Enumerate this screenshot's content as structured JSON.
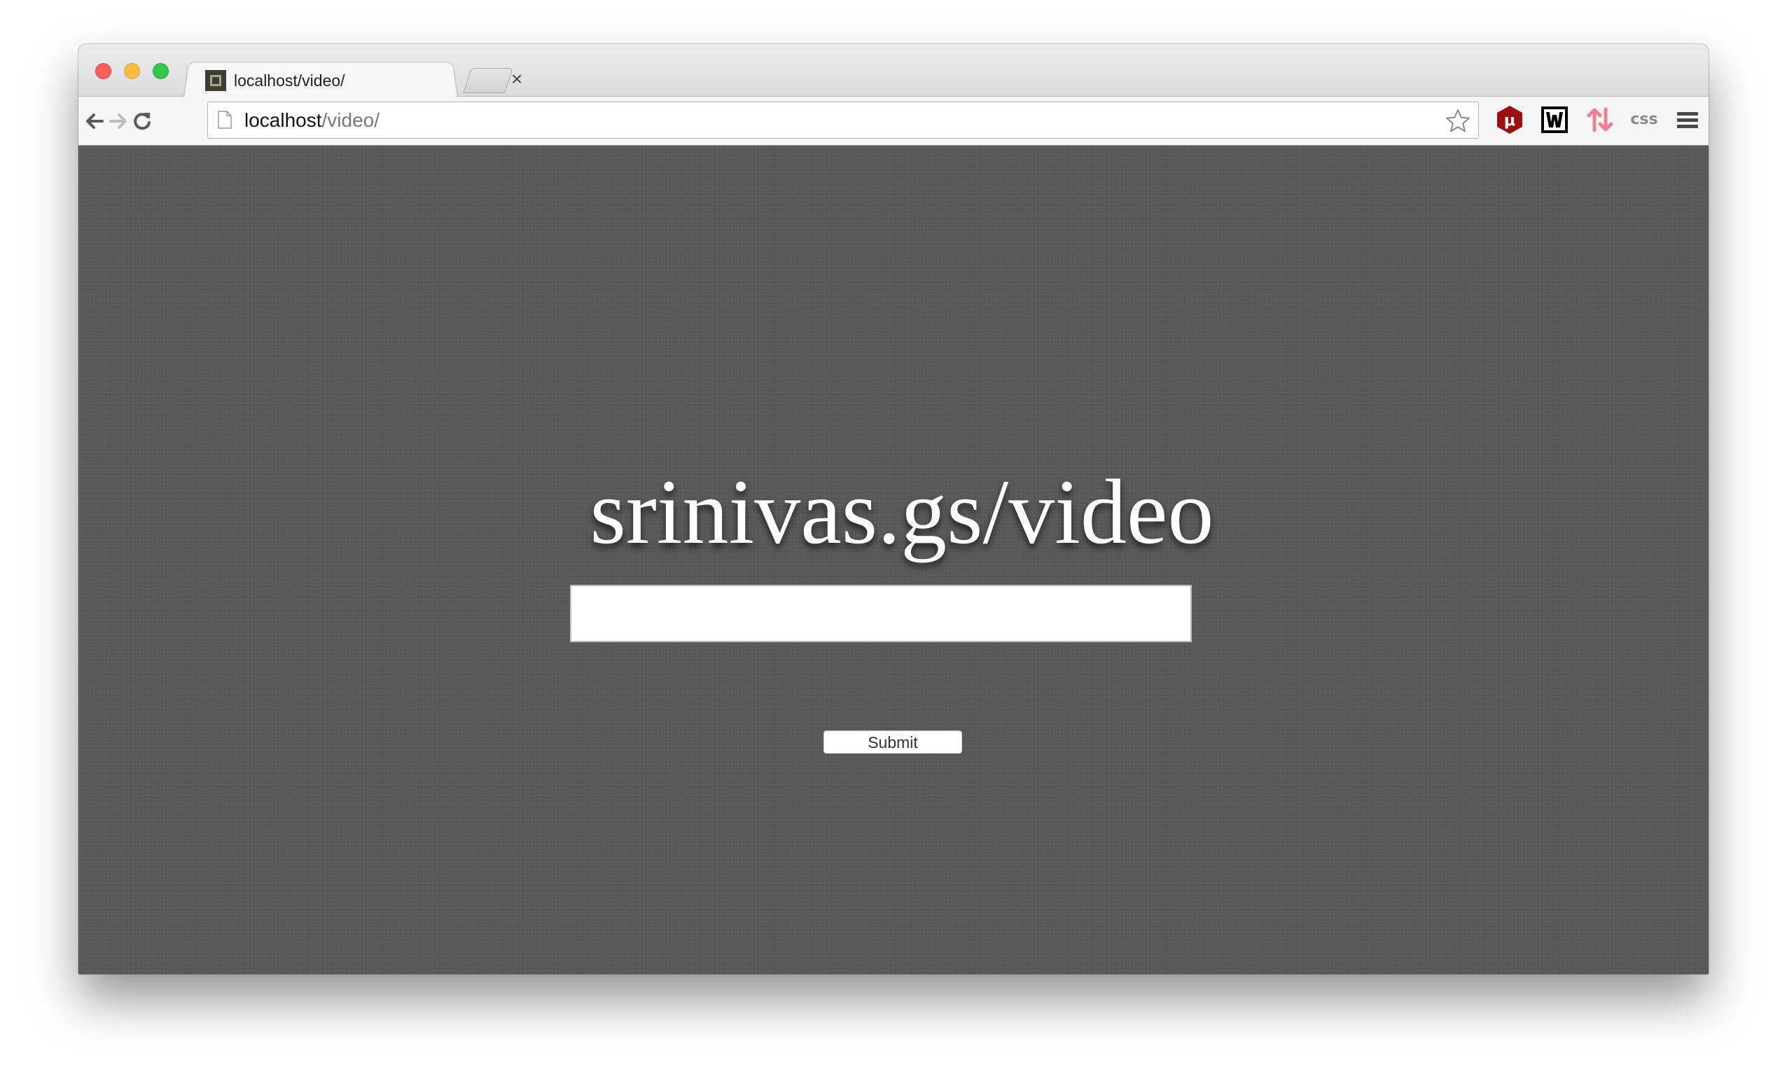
{
  "browser": {
    "tab": {
      "title": "localhost/video/",
      "close_glyph": "×",
      "favicon": "square-favicon-icon"
    },
    "new_tab_icon": "new-tab-icon",
    "toolbar": {
      "back_icon": "back-arrow-icon",
      "forward_icon": "forward-arrow-icon",
      "reload_icon": "reload-icon",
      "url_host": "localhost",
      "url_path": "/video/",
      "bookmark_icon": "star-icon",
      "extensions": [
        {
          "name": "ublock-icon",
          "glyph": "μ",
          "color": "#9b1010"
        },
        {
          "name": "w-extension-icon",
          "glyph": "w",
          "color": "#000000"
        },
        {
          "name": "transfer-arrows-icon",
          "color": "#f07f93"
        },
        {
          "name": "css-extension-icon",
          "label": "css",
          "color": "#8a8a8a"
        }
      ],
      "menu_icon": "hamburger-menu-icon"
    }
  },
  "page": {
    "title": "srinivas.gs/video",
    "input_value": "",
    "input_placeholder": "",
    "submit_label": "Submit",
    "background_color": "#595959",
    "title_color": "#ffffff"
  }
}
